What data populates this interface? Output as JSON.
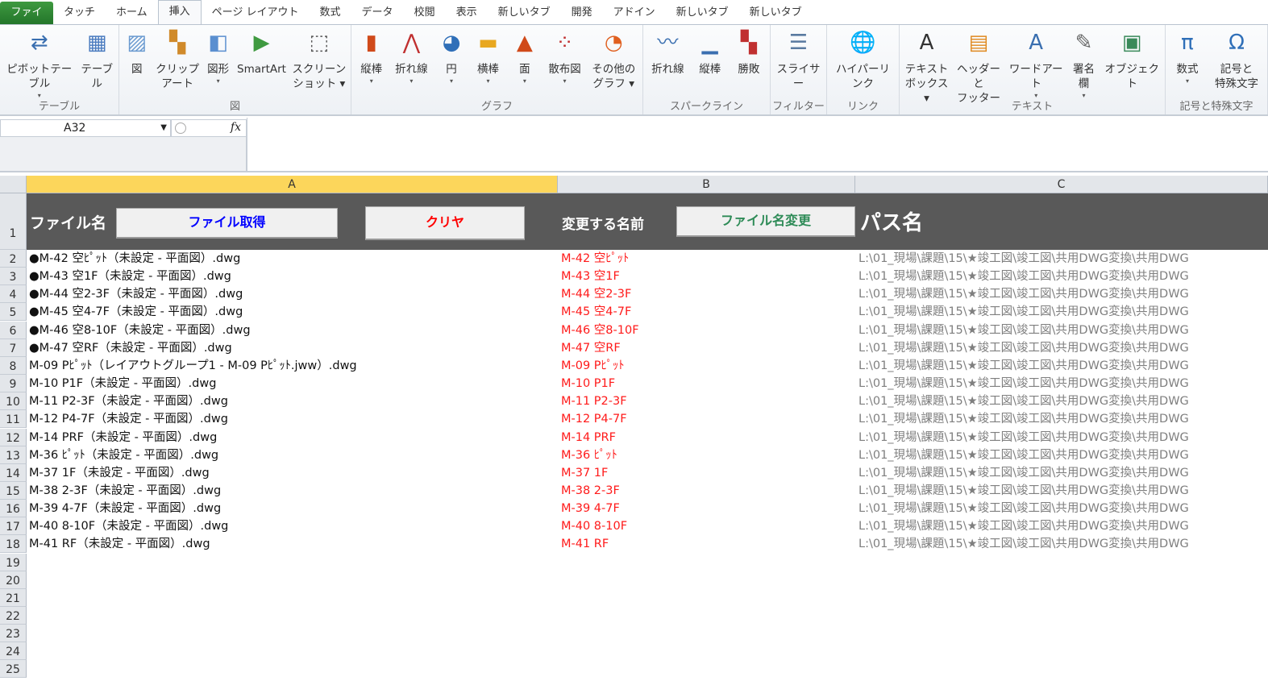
{
  "tabs": [
    "ファイル",
    "タッチ",
    "ホーム",
    "挿入",
    "ページ レイアウト",
    "数式",
    "データ",
    "校閲",
    "表示",
    "新しいタブ",
    "開発",
    "アドイン",
    "新しいタブ",
    "新しいタブ"
  ],
  "ribbon": {
    "groups": [
      {
        "label": "テーブル",
        "buttons": [
          {
            "l1": "ピボットテーブル",
            "l2": "▾",
            "icon": "pivot-table-icon"
          },
          {
            "l1": "テーブル",
            "l2": "",
            "icon": "table-icon"
          }
        ]
      },
      {
        "label": "図",
        "buttons": [
          {
            "l1": "図",
            "l2": "",
            "icon": "picture-icon"
          },
          {
            "l1": "クリップ",
            "l2": "アート",
            "icon": "clip-art-icon"
          },
          {
            "l1": "図形",
            "l2": "▾",
            "icon": "shapes-icon"
          },
          {
            "l1": "SmartArt",
            "l2": "",
            "icon": "smartart-icon"
          },
          {
            "l1": "スクリーン",
            "l2": "ショット ▾",
            "icon": "screenshot-icon"
          }
        ]
      },
      {
        "label": "グラフ",
        "buttons": [
          {
            "l1": "縦棒",
            "l2": "▾",
            "icon": "column-chart-icon"
          },
          {
            "l1": "折れ線",
            "l2": "▾",
            "icon": "line-chart-icon"
          },
          {
            "l1": "円",
            "l2": "▾",
            "icon": "pie-chart-icon"
          },
          {
            "l1": "横棒",
            "l2": "▾",
            "icon": "bar-chart-icon"
          },
          {
            "l1": "面",
            "l2": "▾",
            "icon": "area-chart-icon"
          },
          {
            "l1": "散布図",
            "l2": "▾",
            "icon": "scatter-chart-icon"
          },
          {
            "l1": "その他の",
            "l2": "グラフ ▾",
            "icon": "other-charts-icon"
          }
        ]
      },
      {
        "label": "スパークライン",
        "buttons": [
          {
            "l1": "折れ線",
            "l2": "",
            "icon": "sparkline-line-icon"
          },
          {
            "l1": "縦棒",
            "l2": "",
            "icon": "sparkline-column-icon"
          },
          {
            "l1": "勝敗",
            "l2": "",
            "icon": "sparkline-winloss-icon"
          }
        ]
      },
      {
        "label": "フィルター",
        "buttons": [
          {
            "l1": "スライサー",
            "l2": "",
            "icon": "slicer-icon"
          }
        ]
      },
      {
        "label": "リンク",
        "buttons": [
          {
            "l1": "ハイパーリンク",
            "l2": "",
            "icon": "hyperlink-icon"
          }
        ]
      },
      {
        "label": "テキスト",
        "buttons": [
          {
            "l1": "テキスト",
            "l2": "ボックス ▾",
            "icon": "textbox-icon"
          },
          {
            "l1": "ヘッダーと",
            "l2": "フッター",
            "icon": "header-footer-icon"
          },
          {
            "l1": "ワードアート",
            "l2": "▾",
            "icon": "wordart-icon"
          },
          {
            "l1": "署名欄",
            "l2": "▾",
            "icon": "signature-icon"
          },
          {
            "l1": "オブジェクト",
            "l2": "",
            "icon": "object-icon"
          }
        ]
      },
      {
        "label": "記号と特殊文字",
        "buttons": [
          {
            "l1": "数式",
            "l2": "▾",
            "icon": "equation-icon"
          },
          {
            "l1": "記号と",
            "l2": "特殊文字",
            "icon": "symbol-icon"
          }
        ]
      }
    ]
  },
  "formula_bar": {
    "name_box": "A32",
    "fx": "fx",
    "value": ""
  },
  "columns": [
    "A",
    "B",
    "C"
  ],
  "header_row": {
    "file_label": "ファイル名",
    "get_button": "ファイル取得",
    "clear_button": "クリヤ",
    "rename_label": "変更する名前",
    "rename_button": "ファイル名変更",
    "path_label": "パス名"
  },
  "colors": {
    "get_button": "#0000ff",
    "clear_button": "#ff0000",
    "rename_button": "#2e8b57",
    "header_bg": "#595959"
  },
  "rows": [
    {
      "n": "2",
      "a": "●M-42 空ﾋﾟｯﾄ（未設定 - 平面図）.dwg",
      "b": "M-42 空ﾋﾟｯﾄ",
      "c": "L:\\01_現場\\課題\\15\\★竣工図\\竣工図\\共用DWG変換\\共用DWG"
    },
    {
      "n": "3",
      "a": "●M-43 空1F（未設定 - 平面図）.dwg",
      "b": "M-43 空1F",
      "c": "L:\\01_現場\\課題\\15\\★竣工図\\竣工図\\共用DWG変換\\共用DWG"
    },
    {
      "n": "4",
      "a": "●M-44 空2-3F（未設定 - 平面図）.dwg",
      "b": "M-44 空2-3F",
      "c": "L:\\01_現場\\課題\\15\\★竣工図\\竣工図\\共用DWG変換\\共用DWG"
    },
    {
      "n": "5",
      "a": "●M-45 空4-7F（未設定 - 平面図）.dwg",
      "b": "M-45 空4-7F",
      "c": "L:\\01_現場\\課題\\15\\★竣工図\\竣工図\\共用DWG変換\\共用DWG"
    },
    {
      "n": "6",
      "a": "●M-46 空8-10F（未設定 - 平面図）.dwg",
      "b": "M-46 空8-10F",
      "c": "L:\\01_現場\\課題\\15\\★竣工図\\竣工図\\共用DWG変換\\共用DWG"
    },
    {
      "n": "7",
      "a": "●M-47 空RF（未設定 - 平面図）.dwg",
      "b": "M-47 空RF",
      "c": "L:\\01_現場\\課題\\15\\★竣工図\\竣工図\\共用DWG変換\\共用DWG"
    },
    {
      "n": "8",
      "a": "M-09 Pﾋﾟｯﾄ（レイアウトグループ1 - M-09 Pﾋﾟｯﾄ.jww）.dwg",
      "b": "M-09 Pﾋﾟｯﾄ",
      "c": "L:\\01_現場\\課題\\15\\★竣工図\\竣工図\\共用DWG変換\\共用DWG"
    },
    {
      "n": "9",
      "a": "M-10 P1F（未設定 - 平面図）.dwg",
      "b": "M-10 P1F",
      "c": "L:\\01_現場\\課題\\15\\★竣工図\\竣工図\\共用DWG変換\\共用DWG"
    },
    {
      "n": "10",
      "a": "M-11 P2-3F（未設定 - 平面図）.dwg",
      "b": "M-11 P2-3F",
      "c": "L:\\01_現場\\課題\\15\\★竣工図\\竣工図\\共用DWG変換\\共用DWG"
    },
    {
      "n": "11",
      "a": "M-12 P4-7F（未設定 - 平面図）.dwg",
      "b": "M-12 P4-7F",
      "c": "L:\\01_現場\\課題\\15\\★竣工図\\竣工図\\共用DWG変換\\共用DWG"
    },
    {
      "n": "12",
      "a": "M-14 PRF（未設定 - 平面図）.dwg",
      "b": "M-14 PRF",
      "c": "L:\\01_現場\\課題\\15\\★竣工図\\竣工図\\共用DWG変換\\共用DWG"
    },
    {
      "n": "13",
      "a": "M-36 ﾋﾟｯﾄ（未設定 - 平面図）.dwg",
      "b": "M-36 ﾋﾟｯﾄ",
      "c": "L:\\01_現場\\課題\\15\\★竣工図\\竣工図\\共用DWG変換\\共用DWG"
    },
    {
      "n": "14",
      "a": "M-37 1F（未設定 - 平面図）.dwg",
      "b": "M-37 1F",
      "c": "L:\\01_現場\\課題\\15\\★竣工図\\竣工図\\共用DWG変換\\共用DWG"
    },
    {
      "n": "15",
      "a": "M-38 2-3F（未設定 - 平面図）.dwg",
      "b": "M-38 2-3F",
      "c": "L:\\01_現場\\課題\\15\\★竣工図\\竣工図\\共用DWG変換\\共用DWG"
    },
    {
      "n": "16",
      "a": "M-39 4-7F（未設定 - 平面図）.dwg",
      "b": "M-39 4-7F",
      "c": "L:\\01_現場\\課題\\15\\★竣工図\\竣工図\\共用DWG変換\\共用DWG"
    },
    {
      "n": "17",
      "a": "M-40 8-10F（未設定 - 平面図）.dwg",
      "b": "M-40 8-10F",
      "c": "L:\\01_現場\\課題\\15\\★竣工図\\竣工図\\共用DWG変換\\共用DWG"
    },
    {
      "n": "18",
      "a": "M-41 RF（未設定 - 平面図）.dwg",
      "b": "M-41 RF",
      "c": "L:\\01_現場\\課題\\15\\★竣工図\\竣工図\\共用DWG変換\\共用DWG"
    },
    {
      "n": "19",
      "a": "",
      "b": "",
      "c": ""
    },
    {
      "n": "20",
      "a": "",
      "b": "",
      "c": ""
    },
    {
      "n": "21",
      "a": "",
      "b": "",
      "c": ""
    },
    {
      "n": "22",
      "a": "",
      "b": "",
      "c": ""
    },
    {
      "n": "23",
      "a": "",
      "b": "",
      "c": ""
    },
    {
      "n": "24",
      "a": "",
      "b": "",
      "c": ""
    },
    {
      "n": "25",
      "a": "",
      "b": "",
      "c": ""
    }
  ],
  "row1_number": "1"
}
